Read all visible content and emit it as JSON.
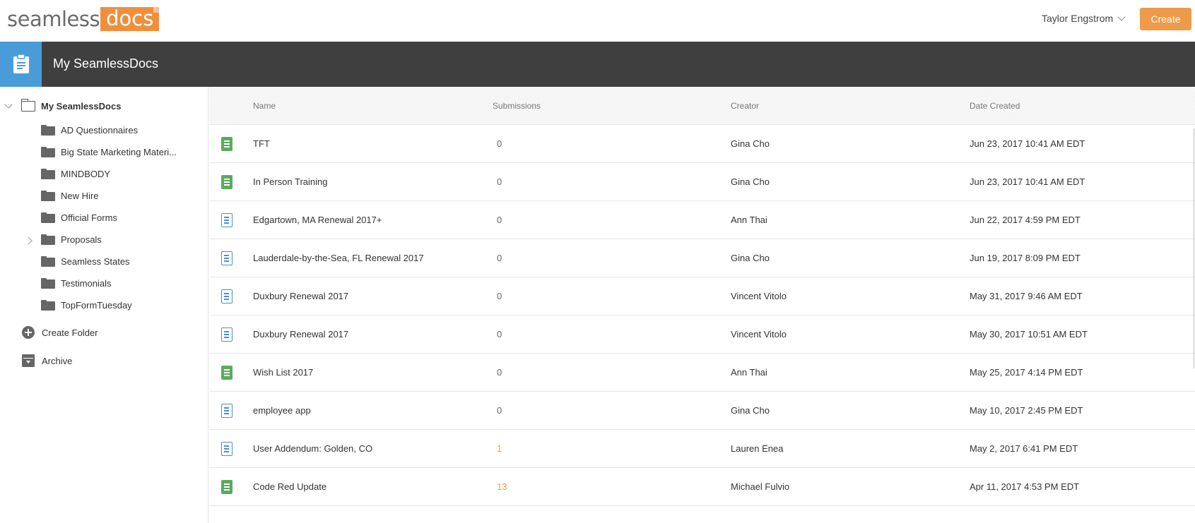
{
  "brand": {
    "logo_word": "seamless",
    "logo_box": "docs",
    "accent": "#ef9a4a",
    "header_accent": "#4a9cd9"
  },
  "topbar": {
    "user_name": "Taylor Engstrom",
    "create_label": "Create"
  },
  "header": {
    "title": "My SeamlessDocs",
    "icon": "clipboard-icon"
  },
  "sidebar": {
    "root_label": "My SeamlessDocs",
    "folders": [
      {
        "label": "AD Questionnaires"
      },
      {
        "label": "Big State Marketing Materi..."
      },
      {
        "label": "MINDBODY"
      },
      {
        "label": "New Hire"
      },
      {
        "label": "Official Forms"
      },
      {
        "label": "Proposals",
        "expandable": true
      },
      {
        "label": "Seamless States"
      },
      {
        "label": "Testimonials"
      },
      {
        "label": "TopFormTuesday"
      }
    ],
    "create_folder_label": "Create Folder",
    "archive_label": "Archive"
  },
  "table": {
    "columns": [
      "Name",
      "Submissions",
      "Creator",
      "Date Created"
    ],
    "rows": [
      {
        "name": "TFT",
        "submissions": "0",
        "creator": "Gina Cho",
        "date": "Jun 23, 2017 10:41 AM EDT",
        "icon": "green-form-icon"
      },
      {
        "name": "In Person Training",
        "submissions": "0",
        "creator": "Gina Cho",
        "date": "Jun 23, 2017 10:41 AM EDT",
        "icon": "green-form-icon"
      },
      {
        "name": "Edgartown, MA Renewal 2017+",
        "submissions": "0",
        "creator": "Ann Thai",
        "date": "Jun 22, 2017 4:59 PM EDT",
        "icon": "blue-document-icon"
      },
      {
        "name": "Lauderdale-by-the-Sea, FL Renewal 2017",
        "submissions": "0",
        "creator": "Gina Cho",
        "date": "Jun 19, 2017 8:09 PM EDT",
        "icon": "blue-document-icon"
      },
      {
        "name": "Duxbury Renewal 2017",
        "submissions": "0",
        "creator": "Vincent Vitolo",
        "date": "May 31, 2017 9:46 AM EDT",
        "icon": "blue-document-icon"
      },
      {
        "name": "Duxbury Renewal 2017",
        "submissions": "0",
        "creator": "Vincent Vitolo",
        "date": "May 30, 2017 10:51 AM EDT",
        "icon": "blue-document-icon"
      },
      {
        "name": "Wish List 2017",
        "submissions": "0",
        "creator": "Ann Thai",
        "date": "May 25, 2017 4:14 PM EDT",
        "icon": "green-form-icon"
      },
      {
        "name": "employee app",
        "submissions": "0",
        "creator": "Gina Cho",
        "date": "May 10, 2017 2:45 PM EDT",
        "icon": "blue-document-icon"
      },
      {
        "name": "User Addendum: Golden, CO",
        "submissions": "1",
        "creator": "Lauren Enea",
        "date": "May 2, 2017 6:41 PM EDT",
        "icon": "blue-document-icon"
      },
      {
        "name": "Code Red Update",
        "submissions": "13",
        "creator": "Michael Fulvio",
        "date": "Apr 11, 2017 4:53 PM EDT",
        "icon": "green-form-icon"
      }
    ]
  }
}
